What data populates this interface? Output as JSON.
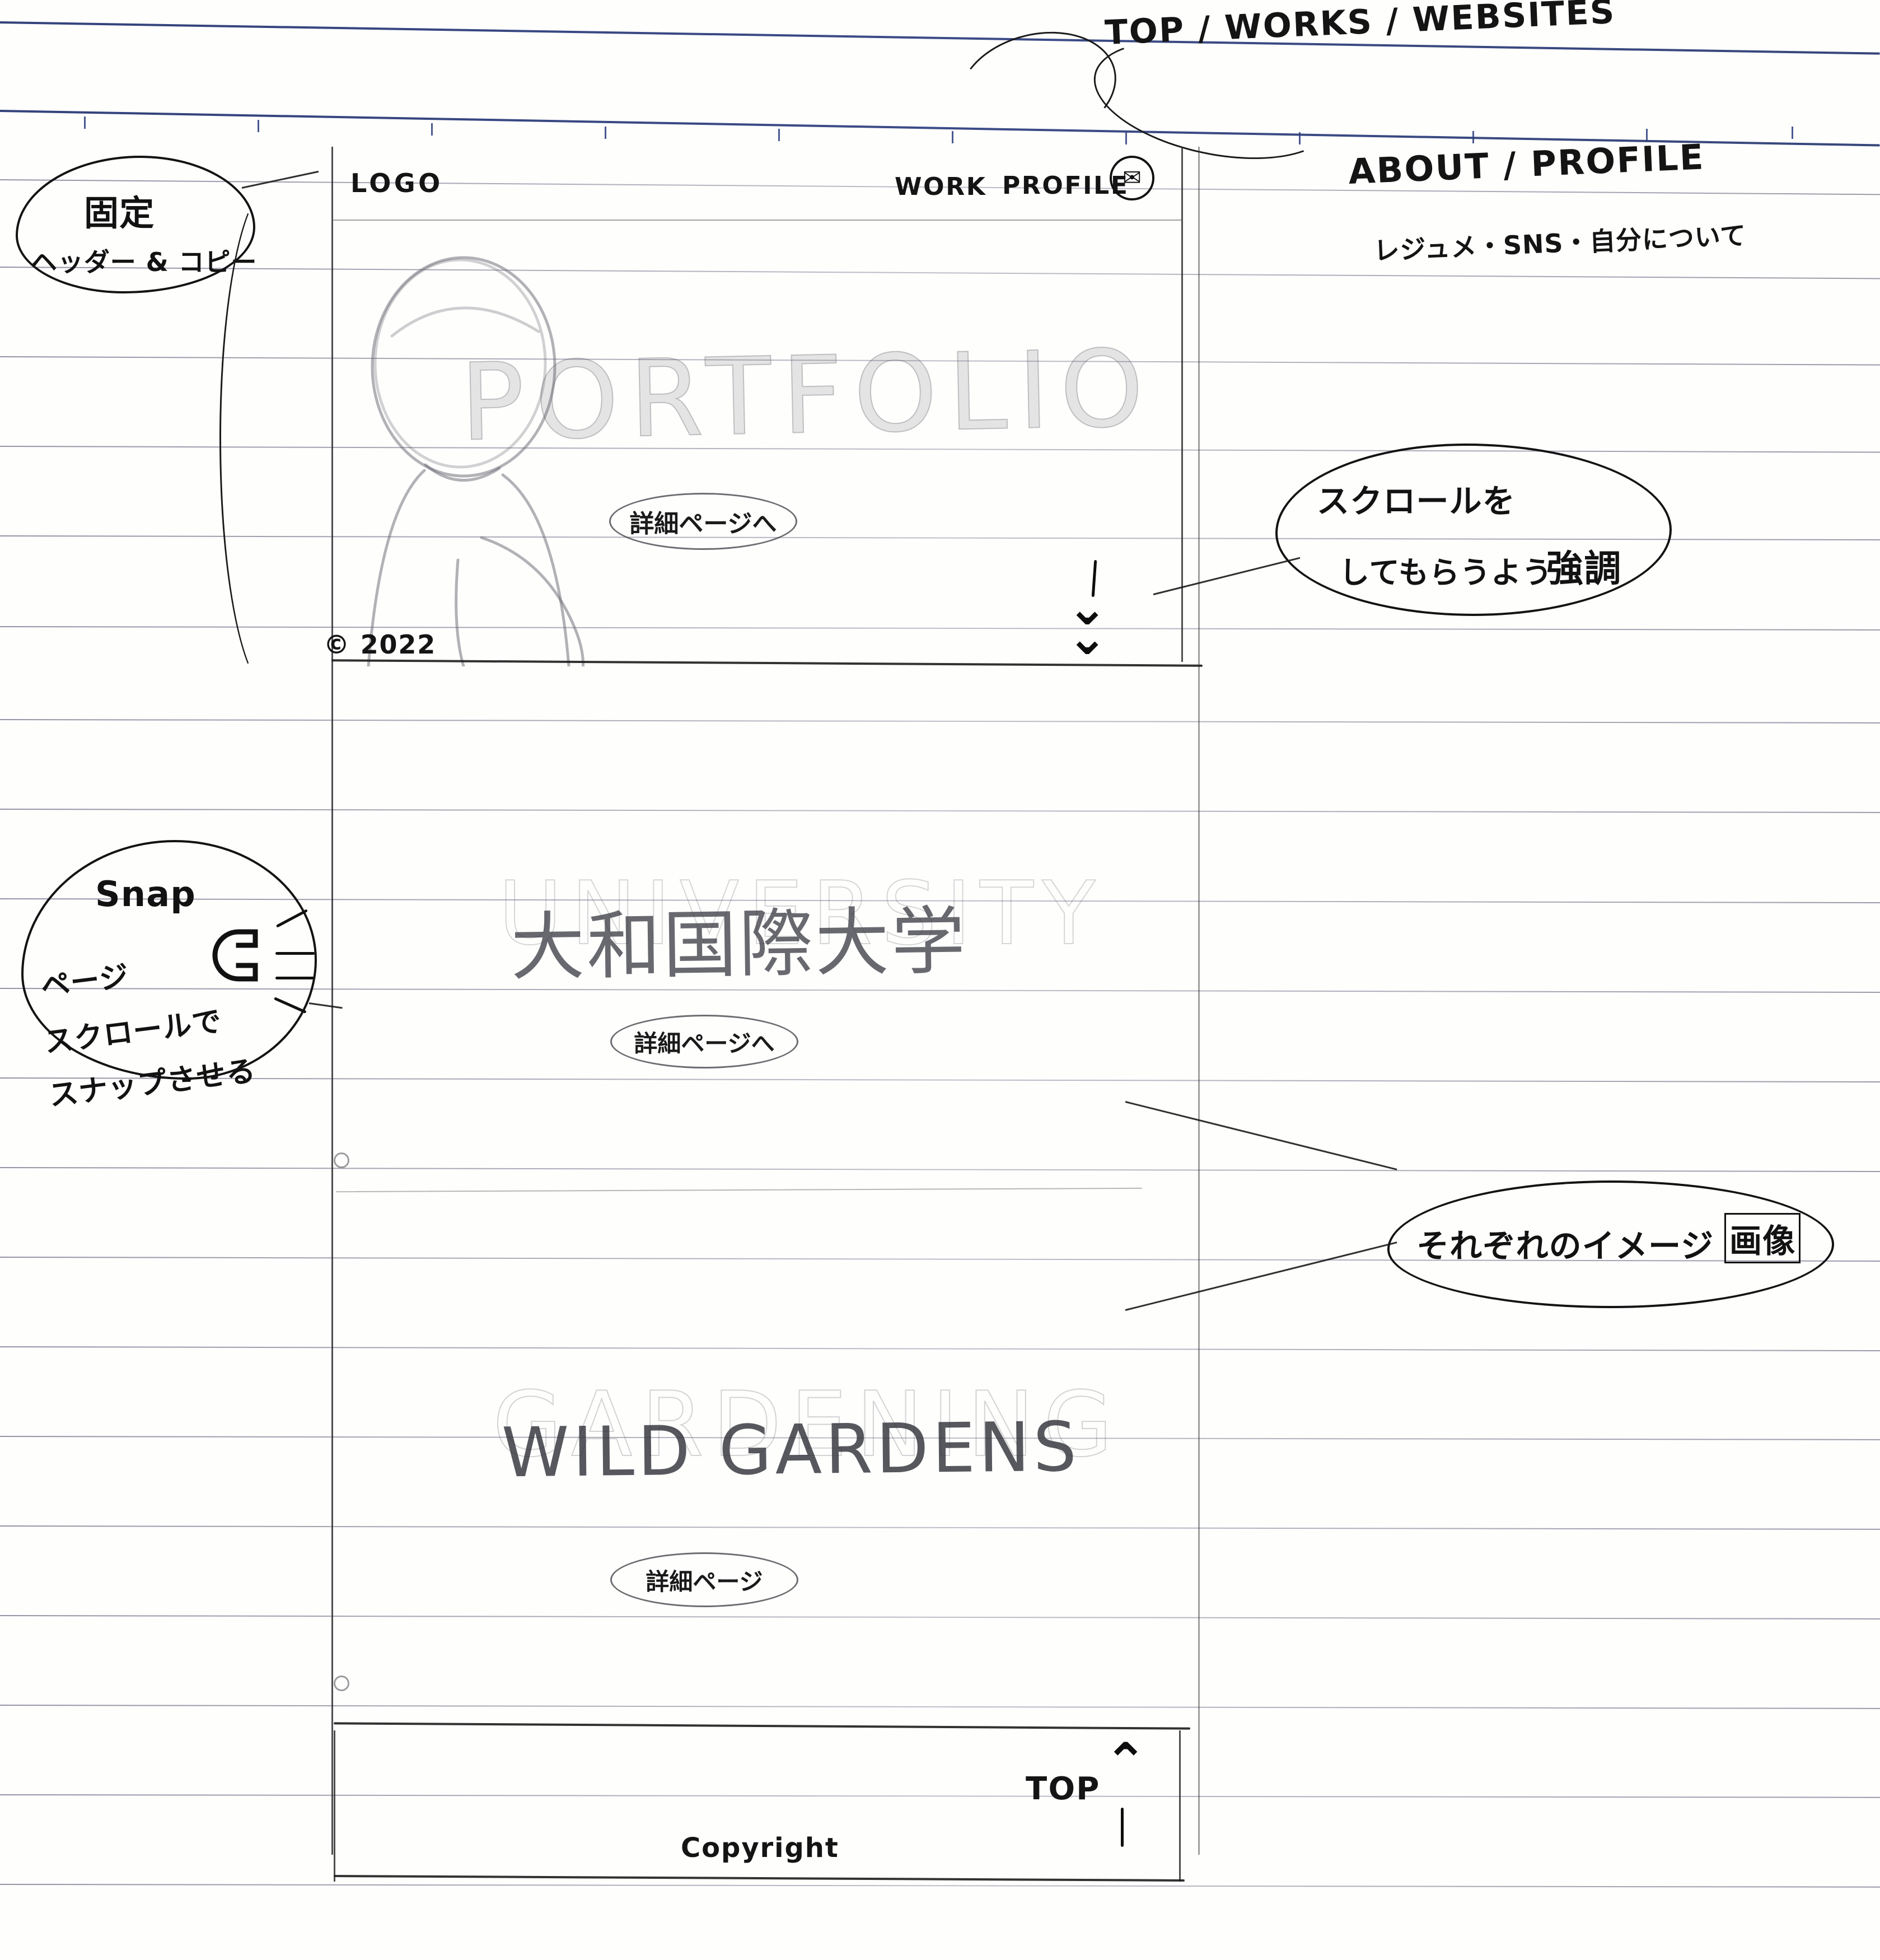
{
  "meta": {
    "kind": "hand-drawn wireframe sketch",
    "title": "Portfolio site wireframe on ruled notebook paper"
  },
  "header": {
    "logo_label": "LOGO",
    "nav": [
      {
        "label": "WORK",
        "name": "nav-work"
      },
      {
        "label": "PROFILE",
        "name": "nav-profile"
      }
    ],
    "contact_icon": "mail-icon",
    "contact_glyph": "✉"
  },
  "hero": {
    "word_pencil": "PORTFOLIO",
    "cta_label": "詳細ページへ",
    "copyright": "© 2022",
    "scroll_hint_icon": "chevron-double-down-icon"
  },
  "sections": [
    {
      "name": "section-university",
      "overlay_word": "UNIVERSITY",
      "title": "大和国際大学",
      "cta_label": "詳細ページへ"
    },
    {
      "name": "section-gardens",
      "overlay_word": "GARDENING",
      "title": "WILD GARDENS",
      "cta_label": "詳細ページ"
    }
  ],
  "footer": {
    "copyright": "Copyright",
    "back_to_top_label": "TOP",
    "back_to_top_icon": "chevron-up-icon"
  },
  "annotations": {
    "top_route": "TOP / WORKS / WEBSITES",
    "about_heading": "ABOUT / PROFILE",
    "about_detail": "レジュメ・SNS・自分について",
    "fixed_header": {
      "line1": "固定",
      "line2": "ヘッダー & コピー"
    },
    "scroll_emphasis": {
      "line1": "スクロールを",
      "line2": "してもらうよう",
      "line2_emphasis": "強調"
    },
    "snap": {
      "title": "Snap",
      "line1": "ページ",
      "line2": "スクロールで",
      "line3": "スナップさせる",
      "icon": "magnet-icon"
    },
    "images": {
      "text_plain": "それぞれのイメージ",
      "text_boxed": "画像"
    }
  },
  "colors": {
    "paper": "#fefefd",
    "rule_gray": "#8a8c9a",
    "rule_blue": "#2b3c7d",
    "ink": "#141414",
    "pencil": "#55555c"
  }
}
